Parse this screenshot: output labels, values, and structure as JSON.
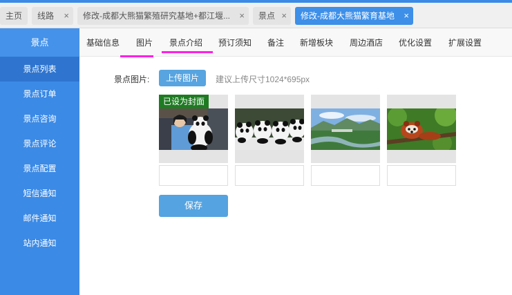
{
  "tabs": [
    {
      "label": "主页",
      "closable": false,
      "active": false
    },
    {
      "label": "线路",
      "closable": true,
      "active": false
    },
    {
      "label": "修改-成都大熊猫繁殖研究基地+都江堰...",
      "closable": true,
      "active": false
    },
    {
      "label": "景点",
      "closable": true,
      "active": false
    },
    {
      "label": "修改-成都大熊猫繁育基地",
      "closable": true,
      "active": true
    }
  ],
  "close_glyph": "×",
  "sidebar": {
    "title": "景点",
    "items": [
      {
        "label": "景点列表",
        "active": true
      },
      {
        "label": "景点订单"
      },
      {
        "label": "景点咨询"
      },
      {
        "label": "景点评论"
      },
      {
        "label": "景点配置"
      },
      {
        "label": "短信通知"
      },
      {
        "label": "邮件通知"
      },
      {
        "label": "站内通知"
      }
    ]
  },
  "subtabs": [
    "基础信息",
    "图片",
    "景点介绍",
    "预订须知",
    "备注",
    "新增板块",
    "周边酒店",
    "优化设置",
    "扩展设置"
  ],
  "highlight_color": "#ff1ee6",
  "form": {
    "image_label": "景点图片:",
    "upload_label": "上传图片",
    "hint": "建议上传尺寸1024*695px",
    "cover_badge": "已设为封面",
    "photos": [
      {
        "subject": "keeper holding panda"
      },
      {
        "subject": "row of panda cubs"
      },
      {
        "subject": "mountain river landscape"
      },
      {
        "subject": "red panda in tree"
      }
    ],
    "captions": [
      "",
      "",
      "",
      ""
    ],
    "save_label": "保存"
  },
  "colors": {
    "accent": "#3b8ae6",
    "sidebar_active": "#2f75cf",
    "button": "#55a3e0",
    "cover_badge": "#1e7b22"
  }
}
